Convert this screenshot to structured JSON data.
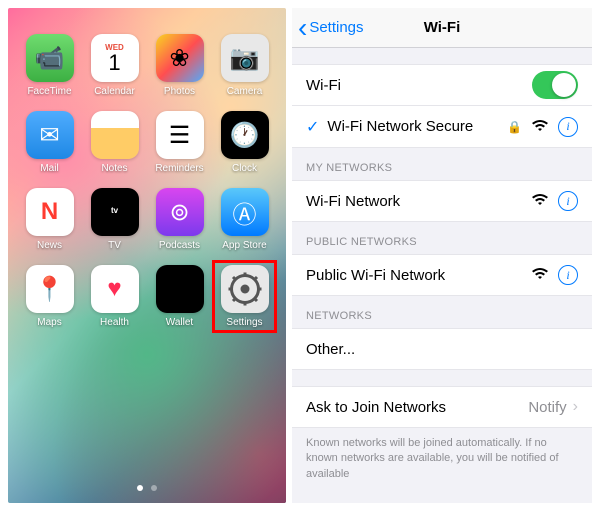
{
  "home": {
    "apps": [
      {
        "label": "FaceTime",
        "name": "facetime"
      },
      {
        "label": "Calendar",
        "name": "calendar",
        "day": "WED",
        "date": "1"
      },
      {
        "label": "Photos",
        "name": "photos"
      },
      {
        "label": "Camera",
        "name": "camera"
      },
      {
        "label": "Mail",
        "name": "mail"
      },
      {
        "label": "Notes",
        "name": "notes"
      },
      {
        "label": "Reminders",
        "name": "reminders"
      },
      {
        "label": "Clock",
        "name": "clock"
      },
      {
        "label": "News",
        "name": "news"
      },
      {
        "label": "TV",
        "name": "tv"
      },
      {
        "label": "Podcasts",
        "name": "podcasts"
      },
      {
        "label": "App Store",
        "name": "appstore"
      },
      {
        "label": "Maps",
        "name": "maps"
      },
      {
        "label": "Health",
        "name": "health"
      },
      {
        "label": "Wallet",
        "name": "wallet"
      },
      {
        "label": "Settings",
        "name": "settings",
        "highlight": true
      }
    ]
  },
  "wifi": {
    "back_label": "Settings",
    "title": "Wi-Fi",
    "toggle_label": "Wi-Fi",
    "toggle_on": true,
    "connected": {
      "name": "Wi-Fi Network Secure",
      "locked": true
    },
    "sections": {
      "my_header": "MY NETWORKS",
      "my": [
        {
          "name": "Wi-Fi Network"
        }
      ],
      "public_header": "PUBLIC NETWORKS",
      "public": [
        {
          "name": "Public Wi-Fi Network"
        }
      ],
      "networks_header": "NETWORKS",
      "other": "Other..."
    },
    "ask": {
      "label": "Ask to Join Networks",
      "value": "Notify"
    },
    "footer": "Known networks will be joined automatically. If no known networks are available, you will be notified of available"
  }
}
